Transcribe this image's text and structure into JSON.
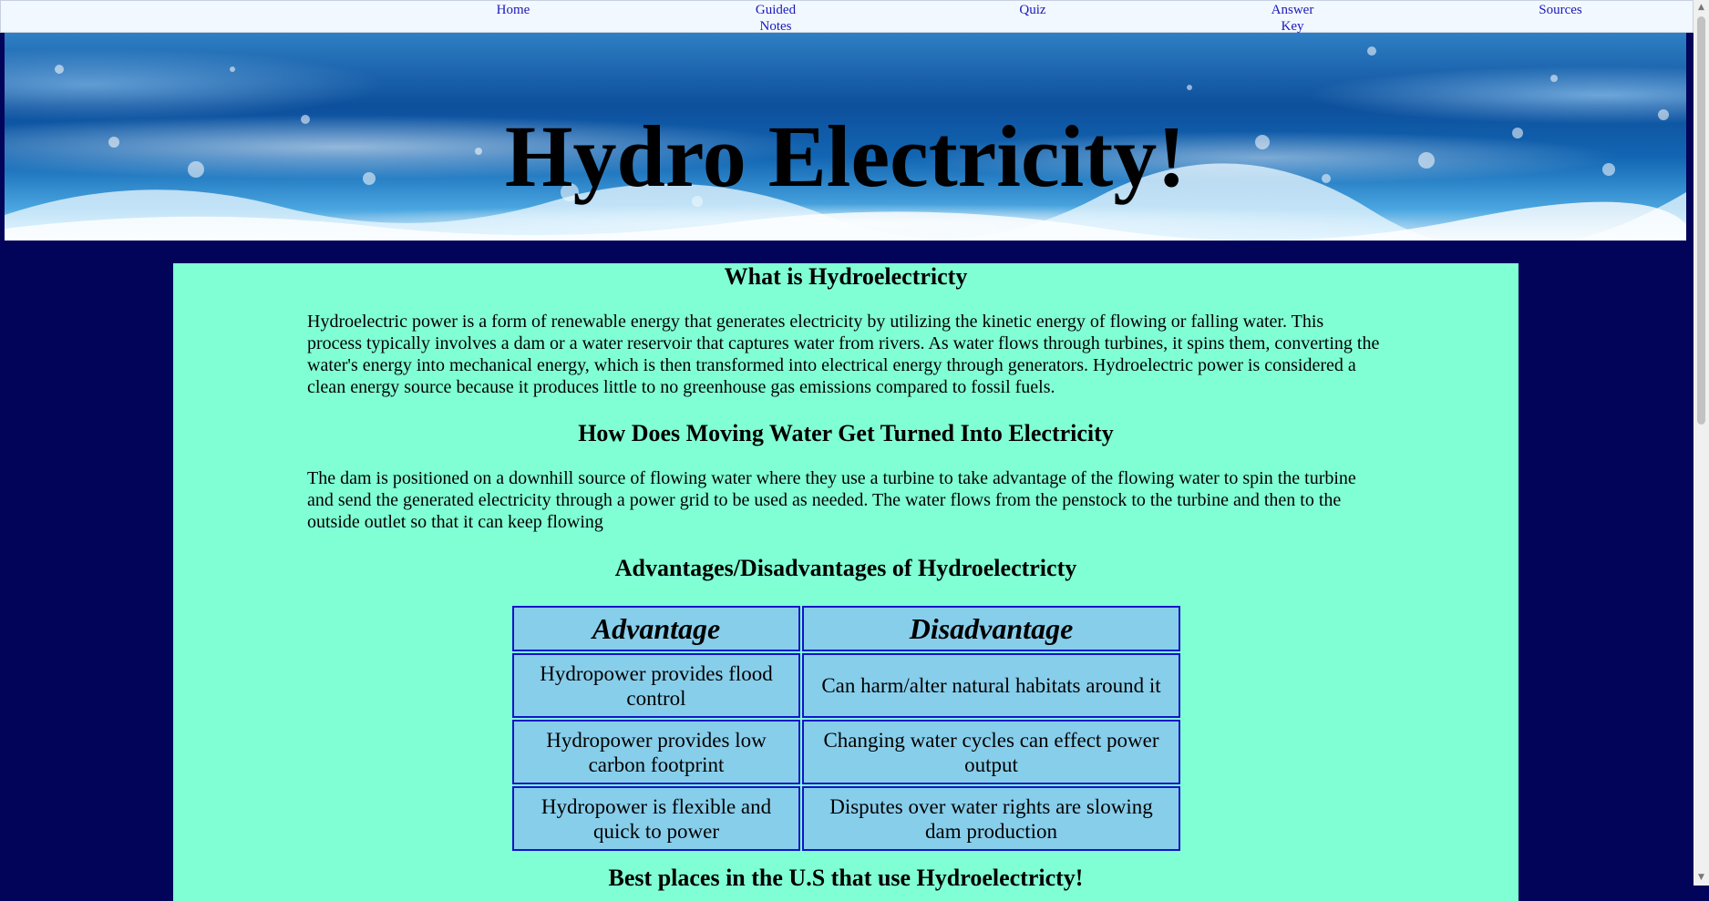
{
  "nav": {
    "items": [
      {
        "label": "Home"
      },
      {
        "label": "Guided\nNotes"
      },
      {
        "label": "Quiz"
      },
      {
        "label": "Answer\nKey"
      },
      {
        "label": "Sources"
      }
    ]
  },
  "banner": {
    "title": "Hydro Electricity!"
  },
  "sections": {
    "what": {
      "heading": "What is Hydroelectricty",
      "body": "Hydroelectric power is a form of renewable energy that generates electricity by utilizing the kinetic energy of flowing or falling water. This process typically involves a dam or a water reservoir that captures water from rivers. As water flows through turbines, it spins them, converting the water's energy into mechanical energy, which is then transformed into electrical energy through generators. Hydroelectric power is considered a clean energy source because it produces little to no greenhouse gas emissions compared to fossil fuels."
    },
    "how": {
      "heading": "How Does Moving Water Get Turned Into Electricity",
      "body": "The dam is positioned on a downhill source of flowing water where they use a turbine to take advantage of the flowing water to spin the turbine and send the generated electricity through a power grid to be used as needed. The water flows from the penstock to the turbine and then to the outside outlet so that it can keep flowing"
    },
    "advdis": {
      "heading": "Advantages/Disadvantages of Hydroelectricty",
      "table": {
        "headers": [
          "Advantage",
          "Disadvantage"
        ],
        "rows": [
          [
            "Hydropower provides flood control",
            "Can harm/alter natural habitats around it"
          ],
          [
            "Hydropower provides low carbon footprint",
            "Changing water cycles can effect power output"
          ],
          [
            "Hydropower is flexible and quick to power",
            "Disputes over water rights are slowing dam production"
          ]
        ]
      }
    },
    "best": {
      "heading": "Best places in the U.S that use Hydroelectricty!"
    }
  },
  "colors": {
    "page_background": "#02045a",
    "content_background": "#80ffd4",
    "table_cell": "#87ceeb",
    "table_border": "#1414c8",
    "nav_link": "#1a1ab8"
  }
}
